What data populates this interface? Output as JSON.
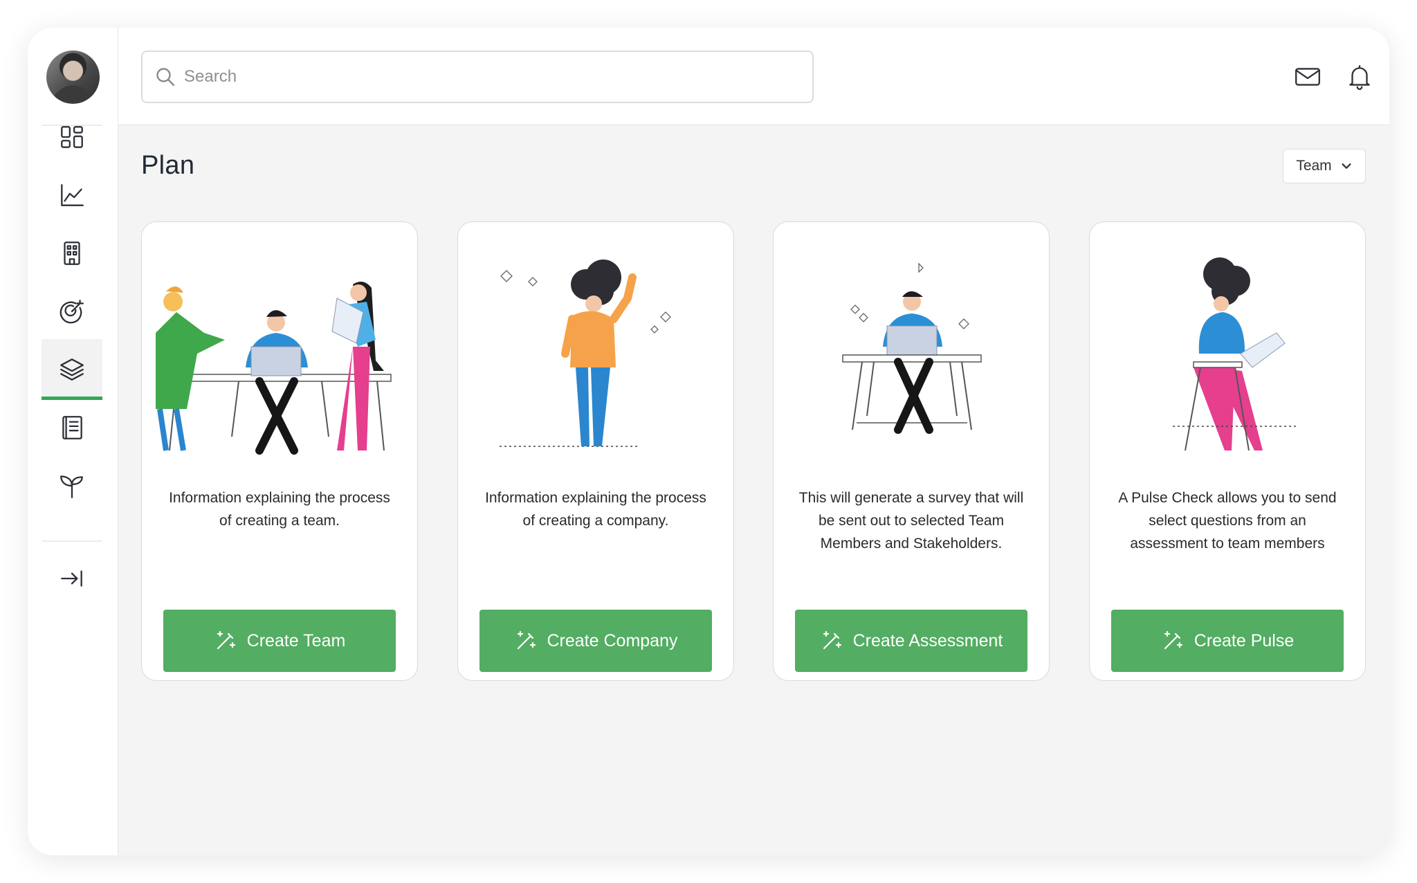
{
  "search": {
    "placeholder": "Search"
  },
  "page": {
    "title": "Plan"
  },
  "filter": {
    "selected": "Team"
  },
  "sidebar": {
    "items": [
      {
        "icon": "dashboard-icon"
      },
      {
        "icon": "analytics-chart-icon"
      },
      {
        "icon": "building-icon"
      },
      {
        "icon": "target-icon"
      },
      {
        "icon": "layers-icon",
        "active": true
      },
      {
        "icon": "book-icon"
      },
      {
        "icon": "sprout-icon"
      },
      {
        "icon": "collapse-arrow-icon"
      }
    ]
  },
  "header": {
    "icons": [
      "mail-icon",
      "bell-icon"
    ]
  },
  "cards": [
    {
      "description": "Information explaining the process of creating a team.",
      "button": "Create Team",
      "illustration": "team-at-desk-illustration"
    },
    {
      "description": "Information explaining the process of creating a company.",
      "button": "Create Company",
      "illustration": "person-standing-illustration"
    },
    {
      "description": "This will generate a survey that will be sent out to selected Team Members and Stakeholders.",
      "button": "Create Assessment",
      "illustration": "person-at-laptop-illustration"
    },
    {
      "description": "A Pulse Check allows you to send select questions from an assessment to team members",
      "button": "Create Pulse",
      "illustration": "person-on-stool-illustration"
    }
  ],
  "colors": {
    "accent": "#53ad62",
    "active_indicator": "#35a853",
    "background": "#f4f4f4",
    "text_dark": "#222a36"
  }
}
